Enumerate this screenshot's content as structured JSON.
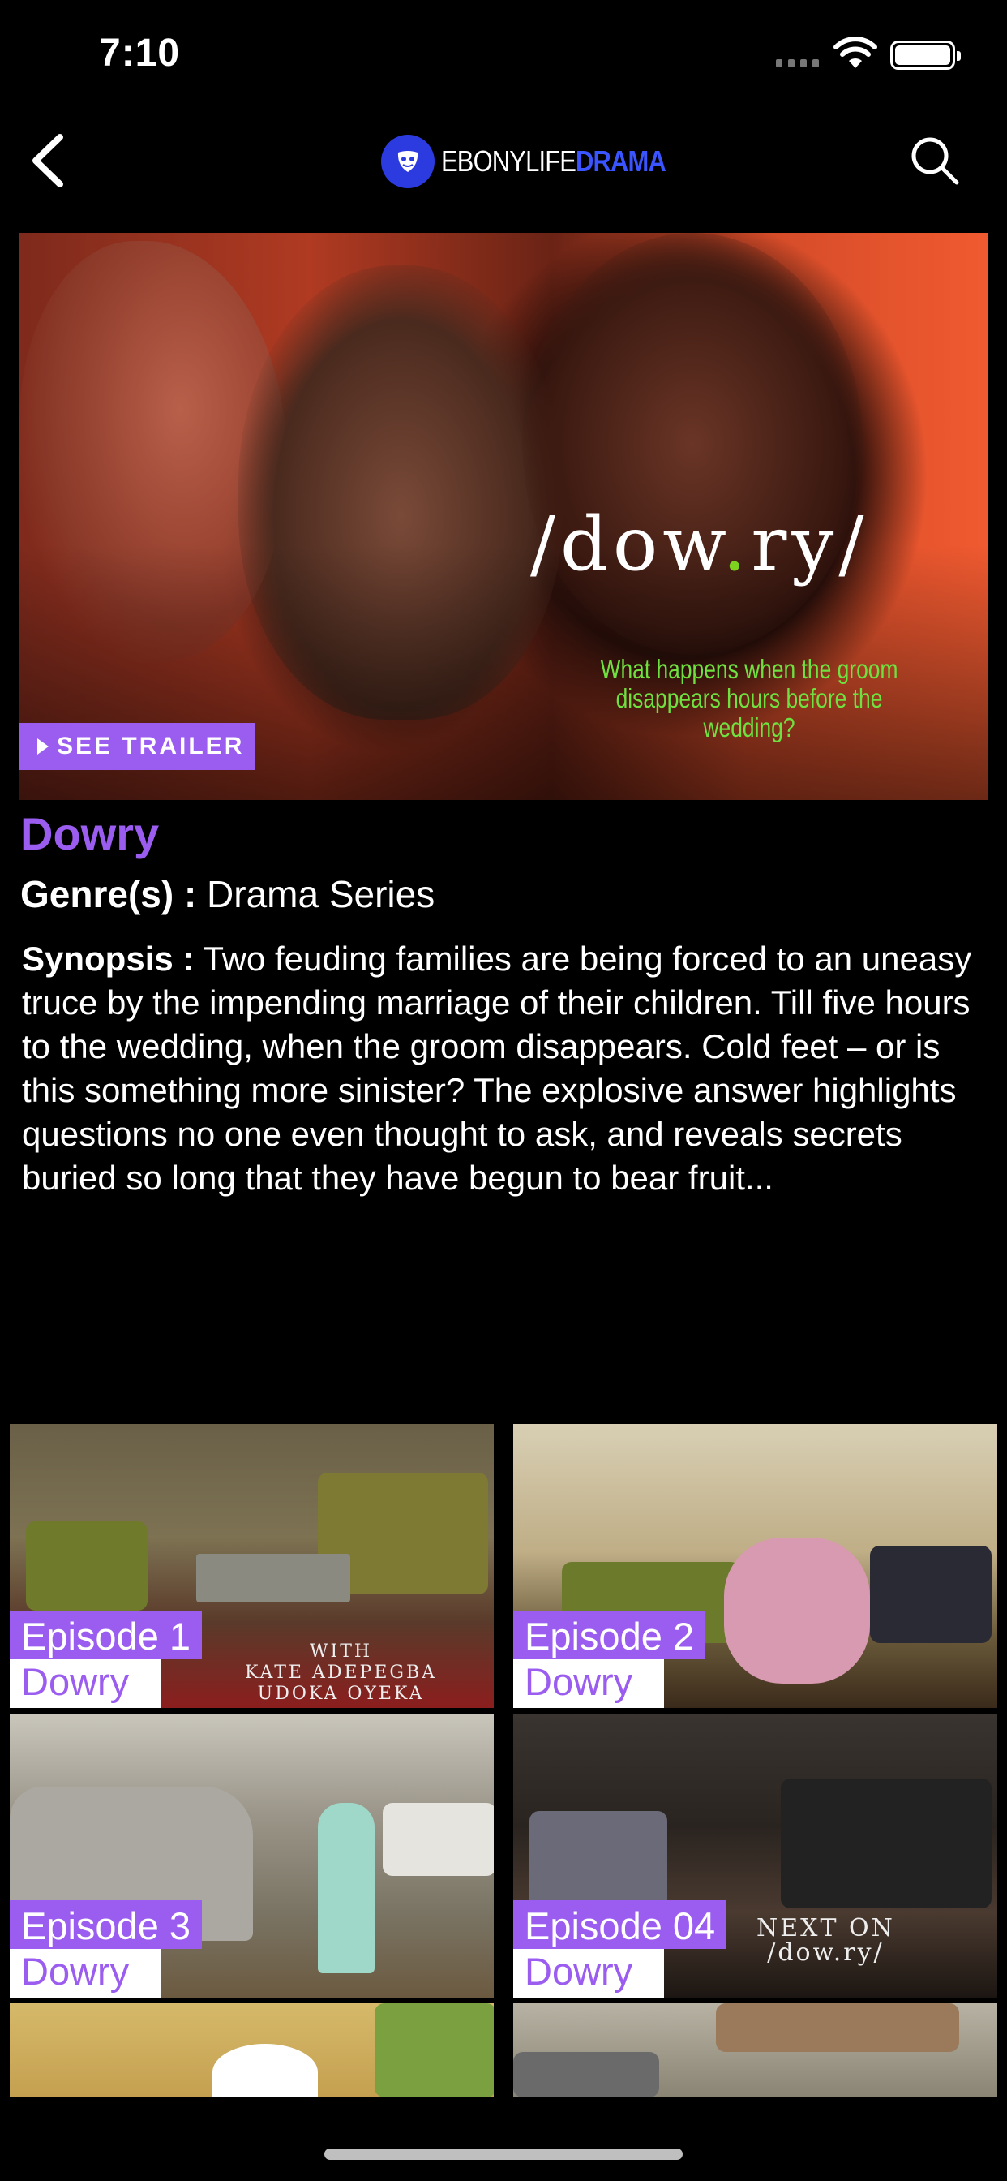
{
  "status_bar": {
    "time": "7:10"
  },
  "nav": {
    "logo_part1": "EBONYLIFE",
    "logo_part2": "DRAMA",
    "icons": [
      "chevron-left-icon",
      "search-icon"
    ]
  },
  "hero": {
    "title_left": "/dow",
    "title_dot": ".",
    "title_right": "ry/",
    "tagline": "What happens when the groom disappears hours before the wedding?",
    "trailer_button_label": "SEE TRAILER"
  },
  "show": {
    "title": "Dowry",
    "genre_label": "Genre(s) :",
    "genre_value": "Drama Series",
    "synopsis_label": "Synopsis :",
    "synopsis_text": "Two feuding families are being forced to an uneasy truce by the impending marriage of their children. Till five hours to the wedding, when the groom disappears. Cold feet – or is this something more sinister? The explosive answer highlights questions no one even thought to ask, and reveals secrets buried so long that they have begun to bear fruit..."
  },
  "episodes": [
    {
      "title": "Episode 1",
      "show": "Dowry",
      "overlay": "WITH\nKATE ADEPEGBA\nUDOKA OYEKA"
    },
    {
      "title": "Episode 2",
      "show": "Dowry",
      "overlay": ""
    },
    {
      "title": "Episode 3",
      "show": "Dowry",
      "overlay": ""
    },
    {
      "title": "Episode 04",
      "show": "Dowry",
      "overlay": "NEXT ON\n/dow.ry/"
    },
    {
      "title": "",
      "show": "",
      "overlay": ""
    },
    {
      "title": "",
      "show": "",
      "overlay": ""
    }
  ],
  "colors": {
    "accent": "#9b5cf0",
    "brand_blue": "#3a54ff",
    "background": "#000000",
    "tagline_green": "#6fe040"
  }
}
